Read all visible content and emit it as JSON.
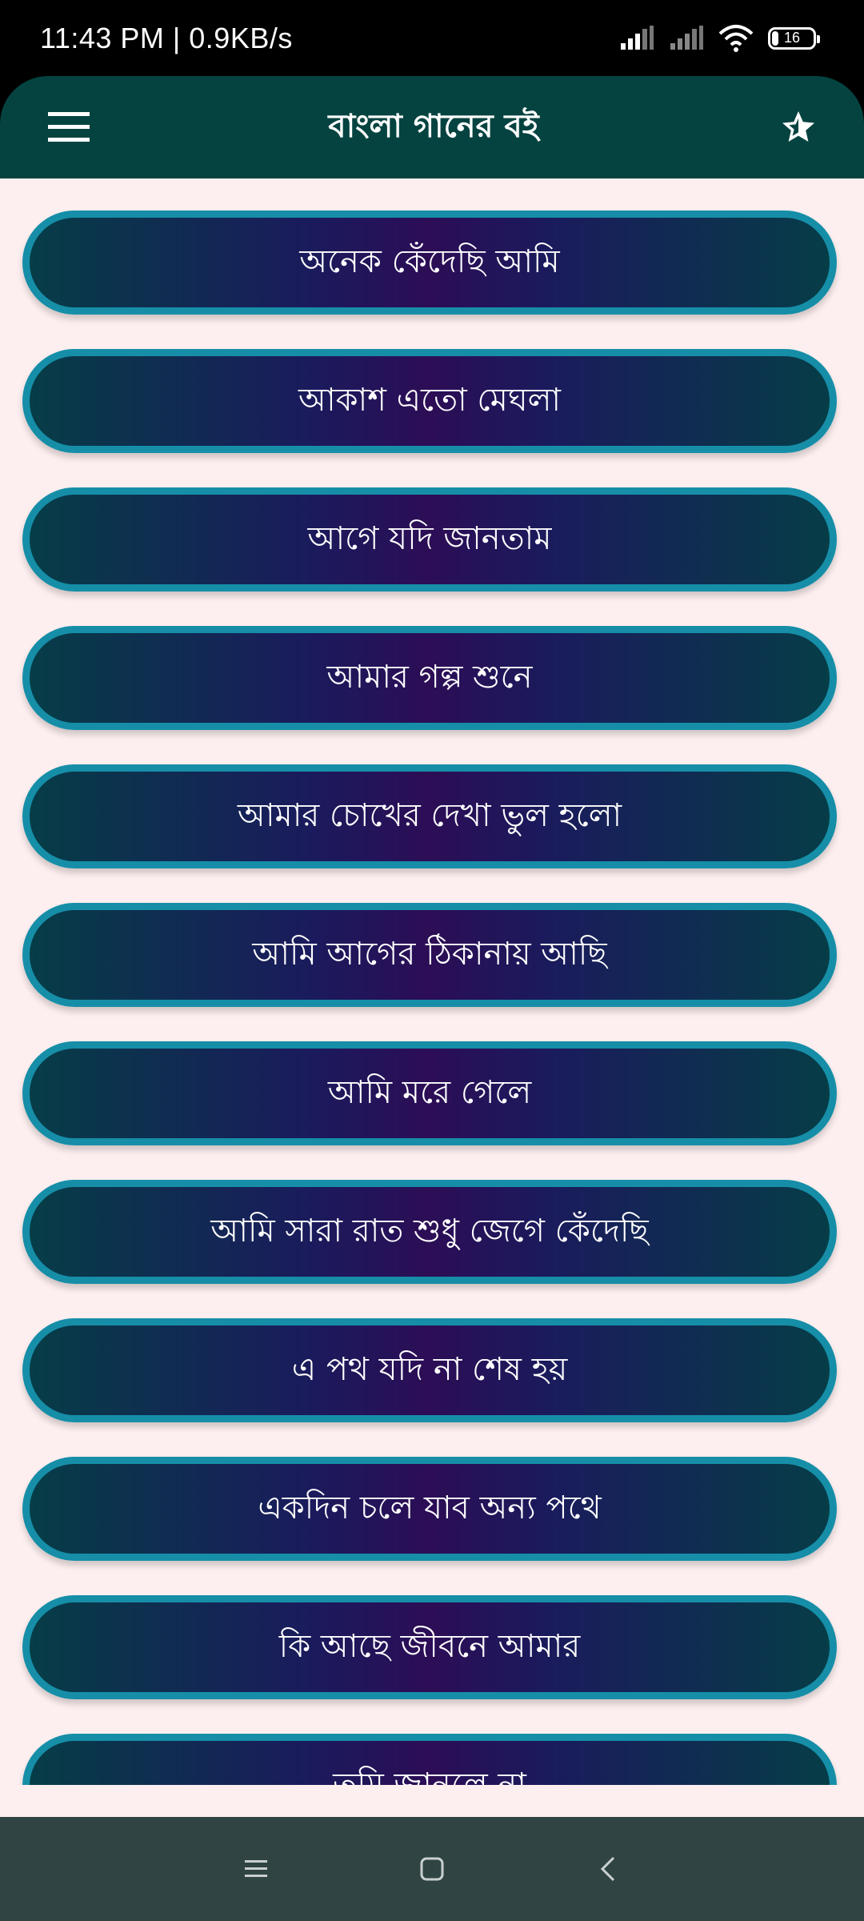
{
  "status_bar": {
    "time_speed": "11:43 PM | 0.9KB/s",
    "battery": "16"
  },
  "app_bar": {
    "title": "বাংলা গানের বই"
  },
  "songs": [
    "অনেক কেঁদেছি আমি",
    "আকাশ এতো মেঘলা",
    "আগে যদি জানতাম",
    "আমার গল্প শুনে",
    "আমার চোখের দেখা ভুল হলো",
    "আমি আগের ঠিকানায় আছি",
    "আমি মরে গেলে",
    "আমি সারা রাত শুধু জেগে কেঁদেছি",
    "এ পথ যদি না শেষ হয়",
    "একদিন চলে যাব অন্য পথে",
    "কি আছে জীবনে আমার",
    "তুমি জানলে না"
  ],
  "colors": {
    "app_bar": "#054340",
    "background": "#fdefef",
    "item_border": "#168ea8",
    "nav_bar": "#2f4443"
  }
}
